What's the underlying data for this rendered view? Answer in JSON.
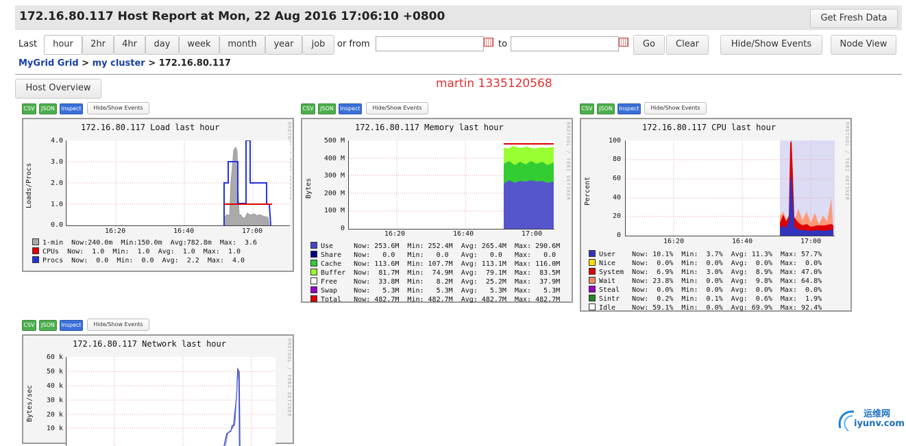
{
  "header": {
    "title": "172.16.80.117 Host Report at Mon, 22 Aug 2016 17:06:10 +0800",
    "refresh_label": "Get Fresh Data"
  },
  "range": {
    "last_label": "Last",
    "options": [
      "hour",
      "2hr",
      "4hr",
      "day",
      "week",
      "month",
      "year",
      "job"
    ],
    "selected": "hour",
    "or_from_label": "or from",
    "from_value": "",
    "to_label": "to",
    "to_value": "",
    "go_label": "Go",
    "clear_label": "Clear"
  },
  "actions": {
    "hide_show_events": "Hide/Show Events",
    "node_view": "Node View"
  },
  "breadcrumb": {
    "grid": "MyGrid Grid",
    "sep1": " > ",
    "cluster": "my cluster",
    "sep2": " > ",
    "host": "172.16.80.117"
  },
  "host_overview_label": "Host Overview",
  "annotation": "martin 1335120568",
  "graph_buttons": {
    "csv": "CSV",
    "json": "JSON",
    "inspect": "Inspect",
    "events": "Hide/Show Events"
  },
  "watermark": "RRDTOOL / TOBI OETIKER",
  "time_ticks": [
    "16:20",
    "16:40",
    "17:00"
  ],
  "graphs": {
    "load": {
      "title": "172.16.80.117 Load last hour",
      "ylabel": "Loads/Procs",
      "yticks": [
        "4.0",
        "3.0",
        "2.0",
        "1.0",
        "0.0"
      ],
      "legend": [
        {
          "name": "1-min",
          "color": "#aaaaaa",
          "now": "Now:240.0m",
          "min": "Min:150.0m",
          "avg": "Avg:782.8m",
          "max": "Max:  3.6"
        },
        {
          "name": "CPUs",
          "color": "#dd0000",
          "now": "Now:  1.0",
          "min": "Min:  1.0",
          "avg": "Avg:  1.0",
          "max": "Max:  1.0"
        },
        {
          "name": "Procs",
          "color": "#2233dd",
          "now": "Now:  0.0",
          "min": "Min:  0.0",
          "avg": "Avg:  2.2",
          "max": "Max:  4.0"
        }
      ]
    },
    "memory": {
      "title": "172.16.80.117 Memory last hour",
      "ylabel": "Bytes",
      "yticks": [
        "500 M",
        "400 M",
        "300 M",
        "200 M",
        "100 M",
        "0"
      ],
      "legend": [
        {
          "name": "Use   ",
          "color": "#4444cc",
          "now": "Now: 253.6M",
          "min": "Min: 252.4M",
          "avg": "Avg: 265.4M",
          "max": "Max: 290.6M"
        },
        {
          "name": "Share ",
          "color": "#000088",
          "now": "Now:   0.0 ",
          "min": "Min:   0.0 ",
          "avg": "Avg:   0.0 ",
          "max": "Max:   0.0 "
        },
        {
          "name": "Cache ",
          "color": "#33cc33",
          "now": "Now: 113.6M",
          "min": "Min: 107.7M",
          "avg": "Avg: 113.1M",
          "max": "Max: 116.0M"
        },
        {
          "name": "Buffer",
          "color": "#99ff33",
          "now": "Now:  81.7M",
          "min": "Min:  74.9M",
          "avg": "Avg:  79.1M",
          "max": "Max:  83.5M"
        },
        {
          "name": "Free  ",
          "color": "#ffffff",
          "now": "Now:  33.8M",
          "min": "Min:   8.2M",
          "avg": "Avg:  25.2M",
          "max": "Max:  37.9M"
        },
        {
          "name": "Swap  ",
          "color": "#9900cc",
          "now": "Now:   5.3M",
          "min": "Min:   5.3M",
          "avg": "Avg:   5.3M",
          "max": "Max:   5.3M"
        },
        {
          "name": "Total ",
          "color": "#dd0000",
          "now": "Now: 482.7M",
          "min": "Min: 482.7M",
          "avg": "Avg: 482.7M",
          "max": "Max: 482.7M"
        }
      ]
    },
    "cpu": {
      "title": "172.16.80.117 CPU last hour",
      "ylabel": "Percent",
      "yticks": [
        "100",
        "80",
        "60",
        "40",
        "20",
        "0"
      ],
      "legend": [
        {
          "name": "User  ",
          "color": "#3333bb",
          "now": "Now: 10.1%",
          "min": "Min:  3.7%",
          "avg": "Avg: 11.3%",
          "max": "Max: 57.7%"
        },
        {
          "name": "Nice  ",
          "color": "#ffdd00",
          "now": "Now:  0.0%",
          "min": "Min:  0.0%",
          "avg": "Avg:  0.0%",
          "max": "Max:  0.0%"
        },
        {
          "name": "System",
          "color": "#dd0000",
          "now": "Now:  6.9%",
          "min": "Min:  3.0%",
          "avg": "Avg:  8.9%",
          "max": "Max: 47.0%"
        },
        {
          "name": "Wait  ",
          "color": "#ff8866",
          "now": "Now: 23.8%",
          "min": "Min:  0.0%",
          "avg": "Avg:  9.8%",
          "max": "Max: 64.8%"
        },
        {
          "name": "Steal ",
          "color": "#9900cc",
          "now": "Now:  0.0%",
          "min": "Min:  0.0%",
          "avg": "Avg:  0.0%",
          "max": "Max:  0.0%"
        },
        {
          "name": "Sintr ",
          "color": "#228822",
          "now": "Now:  0.2%",
          "min": "Min:  0.1%",
          "avg": "Avg:  0.6%",
          "max": "Max:  1.9%"
        },
        {
          "name": "Idle  ",
          "color": "#ffffff",
          "now": "Now: 59.1%",
          "min": "Min:  0.0%",
          "avg": "Avg: 69.9%",
          "max": "Max: 92.4%"
        }
      ]
    },
    "network": {
      "title": "172.16.80.117 Network last hour",
      "ylabel": "Bytes/sec",
      "yticks": [
        "60 k",
        "50 k",
        "40 k",
        "30 k",
        "20 k",
        "10 k"
      ]
    }
  },
  "logo": {
    "text_cn": "运维网",
    "text_en": "iyunv.com"
  },
  "colors": {
    "link": "#1a3fa6",
    "annotation": "#e03030",
    "grid": "#e8a0a0"
  }
}
